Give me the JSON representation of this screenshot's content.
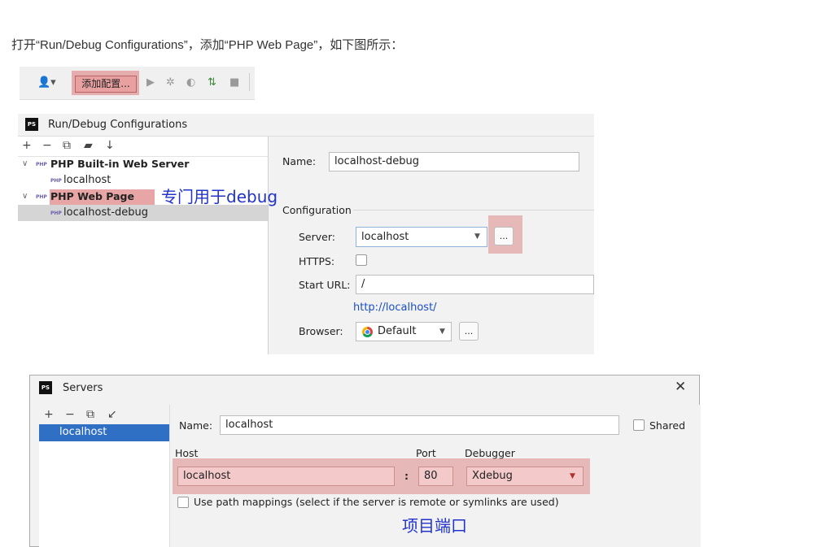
{
  "intro_text": "打开“Run/Debug Configurations”，添加“PHP Web Page”，如下图所示：",
  "toolbar": {
    "add_config_label": "添加配置...",
    "user_icon": "user-dropdown-icon",
    "icons": [
      "run-icon",
      "debug-icon",
      "coverage-icon",
      "profile-icon",
      "stop-icon"
    ]
  },
  "run_debug": {
    "title": "Run/Debug Configurations",
    "logo": "PS",
    "tools": [
      "+",
      "−",
      "⧉",
      "▰",
      "↓"
    ],
    "tree": [
      {
        "label": "PHP Built-in Web Server",
        "bold": true,
        "expanded": true
      },
      {
        "label": "localhost",
        "bold": false
      },
      {
        "label": "PHP Web Page",
        "bold": true,
        "expanded": true
      },
      {
        "label": "localhost-debug",
        "bold": false,
        "selected": true
      }
    ],
    "annotation": "专门用于debug",
    "name_label": "Name:",
    "name_value": "localhost-debug",
    "section_configuration": "Configuration",
    "server_label": "Server:",
    "server_value": "localhost",
    "https_label": "HTTPS:",
    "start_url_label": "Start URL:",
    "start_url_value": "/",
    "url_link": "http://localhost/",
    "browser_label": "Browser:",
    "browser_value": "Default",
    "ellipsis": "..."
  },
  "servers": {
    "title": "Servers",
    "logo": "PS",
    "close": "✕",
    "tools": [
      "+",
      "−",
      "⧉",
      "↙"
    ],
    "list": [
      "localhost"
    ],
    "name_label": "Name:",
    "name_value": "localhost",
    "shared_label": "Shared",
    "host_label": "Host",
    "port_label": "Port",
    "debugger_label": "Debugger",
    "host_value": "localhost",
    "colon": ":",
    "port_value": "80",
    "debugger_value": "Xdebug",
    "path_mappings_label": "Use path mappings (select if the server is remote or symlinks are used)",
    "annotation": "项目端口"
  },
  "colors": {
    "highlight": "#d65a5a",
    "annotation": "#2233cc",
    "selection": "#2f6fc4",
    "link": "#1a4ec8"
  }
}
